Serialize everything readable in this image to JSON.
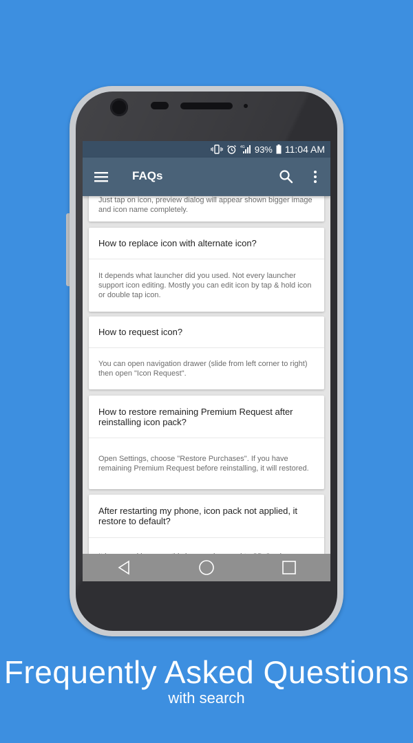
{
  "status_bar": {
    "network_label": "4G",
    "battery": "93%",
    "time": "11:04 AM",
    "icons": [
      "vibrate-icon",
      "alarm-icon",
      "signal-icon",
      "battery-icon"
    ]
  },
  "app_bar": {
    "title": "FAQs",
    "icons": [
      "menu-icon",
      "search-icon",
      "more-vert-icon"
    ]
  },
  "faqs": [
    {
      "question": "",
      "answer": "Just tap on icon, preview dialog will appear shown bigger image and icon name completely."
    },
    {
      "question": "How to replace icon with alternate icon?",
      "answer": "It depends what launcher did you used. Not every launcher support icon editing. Mostly you can edit icon by tap & hold icon or double tap icon."
    },
    {
      "question": "How to request icon?",
      "answer": "You can open navigation drawer (slide from left corner to right) then open \"Icon Request\"."
    },
    {
      "question": "How to restore remaining Premium Request after reinstalling icon pack?",
      "answer": "Open Settings, choose \"Restore Purchases\". If you have remaining Premium Request before reinstalling, it will restored."
    },
    {
      "question": "After restarting my phone, icon pack not applied, it restore to default?",
      "answer": "It happened because this icon pack moved to SD Card, you should install this in internal memory."
    }
  ],
  "nav_bar": {
    "icons": [
      "back-icon",
      "home-icon",
      "recents-icon"
    ]
  },
  "caption": {
    "title": "Frequently Asked Questions",
    "subtitle": "with search"
  },
  "colors": {
    "background": "#3d8fe0",
    "app_bar": "#4a6278",
    "status_bar": "#394f65",
    "screen_bg": "#e4e4e4"
  }
}
